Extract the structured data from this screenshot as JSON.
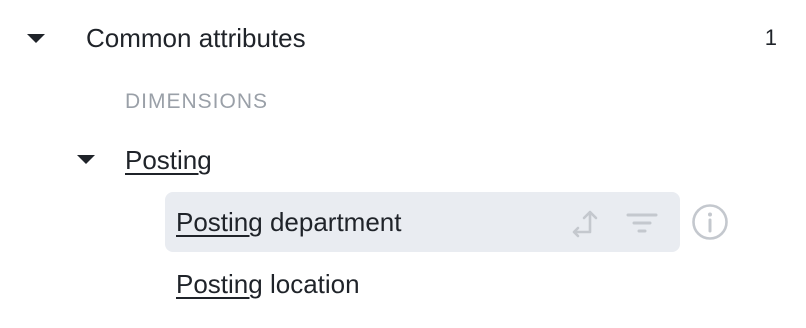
{
  "group": {
    "label": "Common attributes",
    "count": "1"
  },
  "section": {
    "label": "DIMENSIONS"
  },
  "subgroup": {
    "label": "Posting"
  },
  "fields": [
    {
      "highlight": "Posting",
      "rest": " department"
    },
    {
      "highlight": "Posting",
      "rest": " location"
    }
  ],
  "icons": {
    "group_caret": "caret-down-icon",
    "subgroup_caret": "caret-down-icon",
    "pivot": "pivot-arrow-icon",
    "filter": "filter-icon",
    "info": "info-icon"
  },
  "colors": {
    "text": "#1f2329",
    "muted": "#9aa0a8",
    "hover_bg": "#e9ecf1",
    "icon_muted": "#c4c8ce"
  }
}
